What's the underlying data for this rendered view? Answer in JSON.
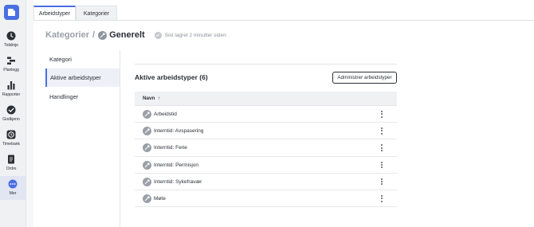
{
  "sidebar": {
    "items": [
      {
        "label": "Tidslinje",
        "icon": "clock-icon"
      },
      {
        "label": "Planlegg",
        "icon": "plan-icon"
      },
      {
        "label": "Rapporter",
        "icon": "bar-chart-icon"
      },
      {
        "label": "Godkjenn",
        "icon": "check-circle-icon"
      },
      {
        "label": "Timebank",
        "icon": "timebank-icon"
      },
      {
        "label": "Ordre",
        "icon": "document-icon"
      },
      {
        "label": "Mer",
        "icon": "more-icon"
      }
    ]
  },
  "tabs": [
    {
      "label": "Arbeidstyper",
      "active": true
    },
    {
      "label": "Kategorier",
      "active": false
    }
  ],
  "header": {
    "breadcrumb": "Kategorier",
    "separator": "/",
    "current": "Generelt",
    "saved_status": "Sist lagret 2 minutter siden"
  },
  "submenu": {
    "items": [
      {
        "label": "Kategori",
        "active": false
      },
      {
        "label": "Aktive arbeidstyper",
        "active": true
      },
      {
        "label": "Handlinger",
        "active": false
      }
    ]
  },
  "main": {
    "title": "Aktive arbeidstyper (6)",
    "admin_button": "Administrer arbeidstyper",
    "table": {
      "column_header": "Navn",
      "sort_indicator": "↑",
      "rows": [
        "Arbeidstid",
        "Interntid: Avspasering",
        "Interntid: Ferie",
        "Interntid: Permisjon",
        "Interntid: Sykefravær",
        "Møte"
      ]
    }
  },
  "colors": {
    "accent": "#4a6fe3",
    "sidebar_bg": "#f0f1f3",
    "text": "#2b2f36",
    "muted": "#9aa0a8"
  }
}
